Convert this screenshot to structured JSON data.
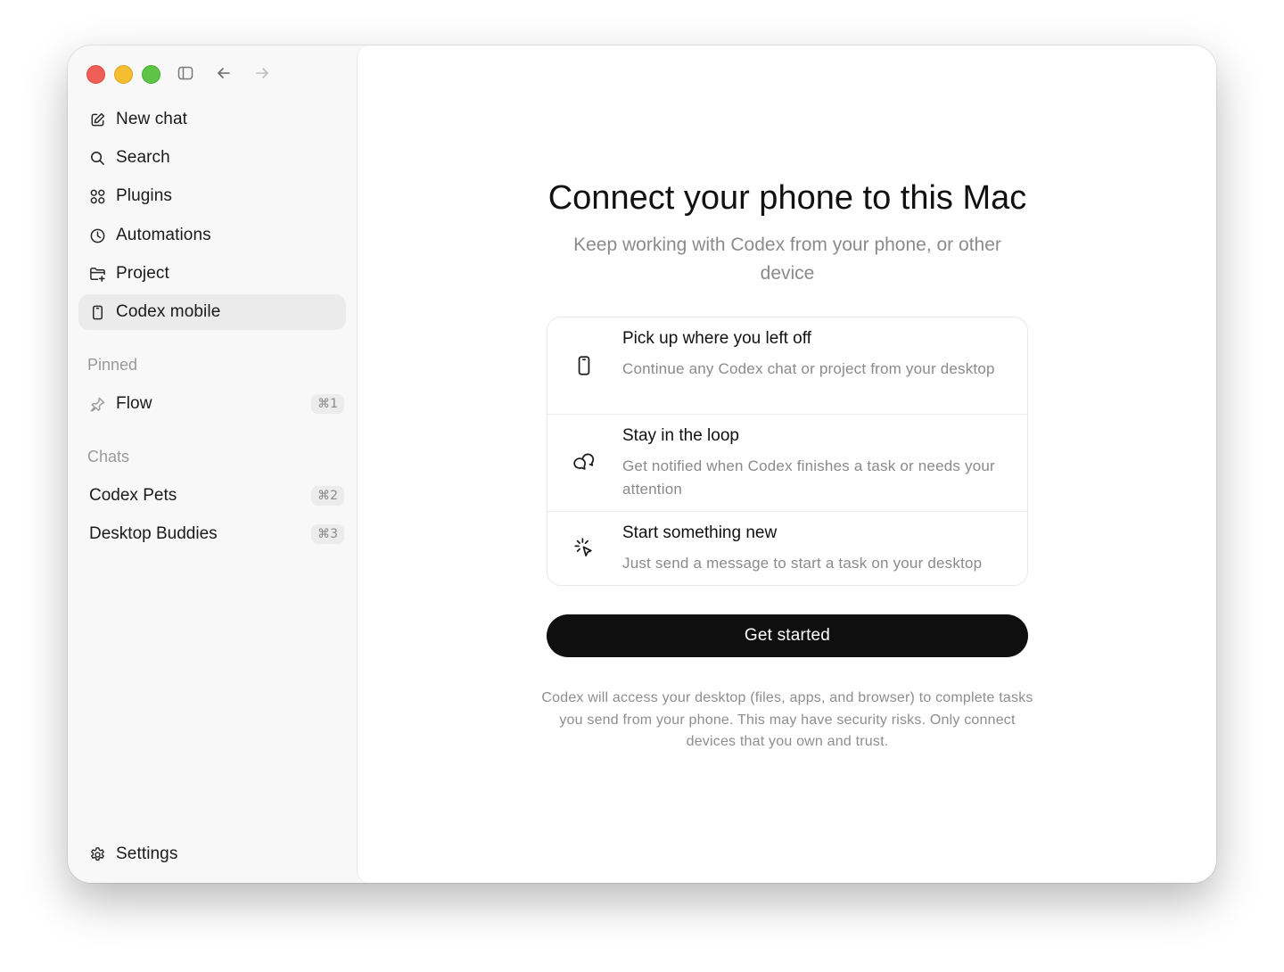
{
  "sidebar": {
    "nav": [
      {
        "label": "New chat",
        "icon": "compose-icon"
      },
      {
        "label": "Search",
        "icon": "search-icon"
      },
      {
        "label": "Plugins",
        "icon": "grid-icon"
      },
      {
        "label": "Automations",
        "icon": "clock-icon"
      },
      {
        "label": "Project",
        "icon": "folder-add-icon"
      },
      {
        "label": "Codex mobile",
        "icon": "phone-icon",
        "active": true
      }
    ],
    "pinned_label": "Pinned",
    "pinned": [
      {
        "label": "Flow",
        "shortcut": "⌘1",
        "icon": "pin-icon"
      }
    ],
    "chats_label": "Chats",
    "chats": [
      {
        "label": "Codex Pets",
        "shortcut": "⌘2"
      },
      {
        "label": "Desktop Buddies",
        "shortcut": "⌘3"
      }
    ],
    "settings_label": "Settings"
  },
  "main": {
    "title": "Connect your phone to this Mac",
    "subtitle": "Keep working with Codex from your phone, or other device",
    "features": [
      {
        "title": "Pick up where you left off",
        "desc": "Continue any Codex chat or project from your desktop",
        "icon": "phone-icon"
      },
      {
        "title": "Stay in the loop",
        "desc": "Get notified when Codex finishes a task or needs your attention",
        "icon": "chat-bubbles-icon"
      },
      {
        "title": "Start something new",
        "desc": "Just send a message to start a task on your desktop",
        "icon": "cursor-click-icon"
      }
    ],
    "cta_label": "Get started",
    "disclaimer": "Codex will access your desktop (files, apps, and browser) to complete tasks you send from your phone. This may have security risks. Only connect devices that you own and trust."
  },
  "colors": {
    "accent": "#0f0f0f",
    "close": "#ef5f57",
    "minimize": "#f5bd30",
    "zoom": "#5dc445"
  }
}
